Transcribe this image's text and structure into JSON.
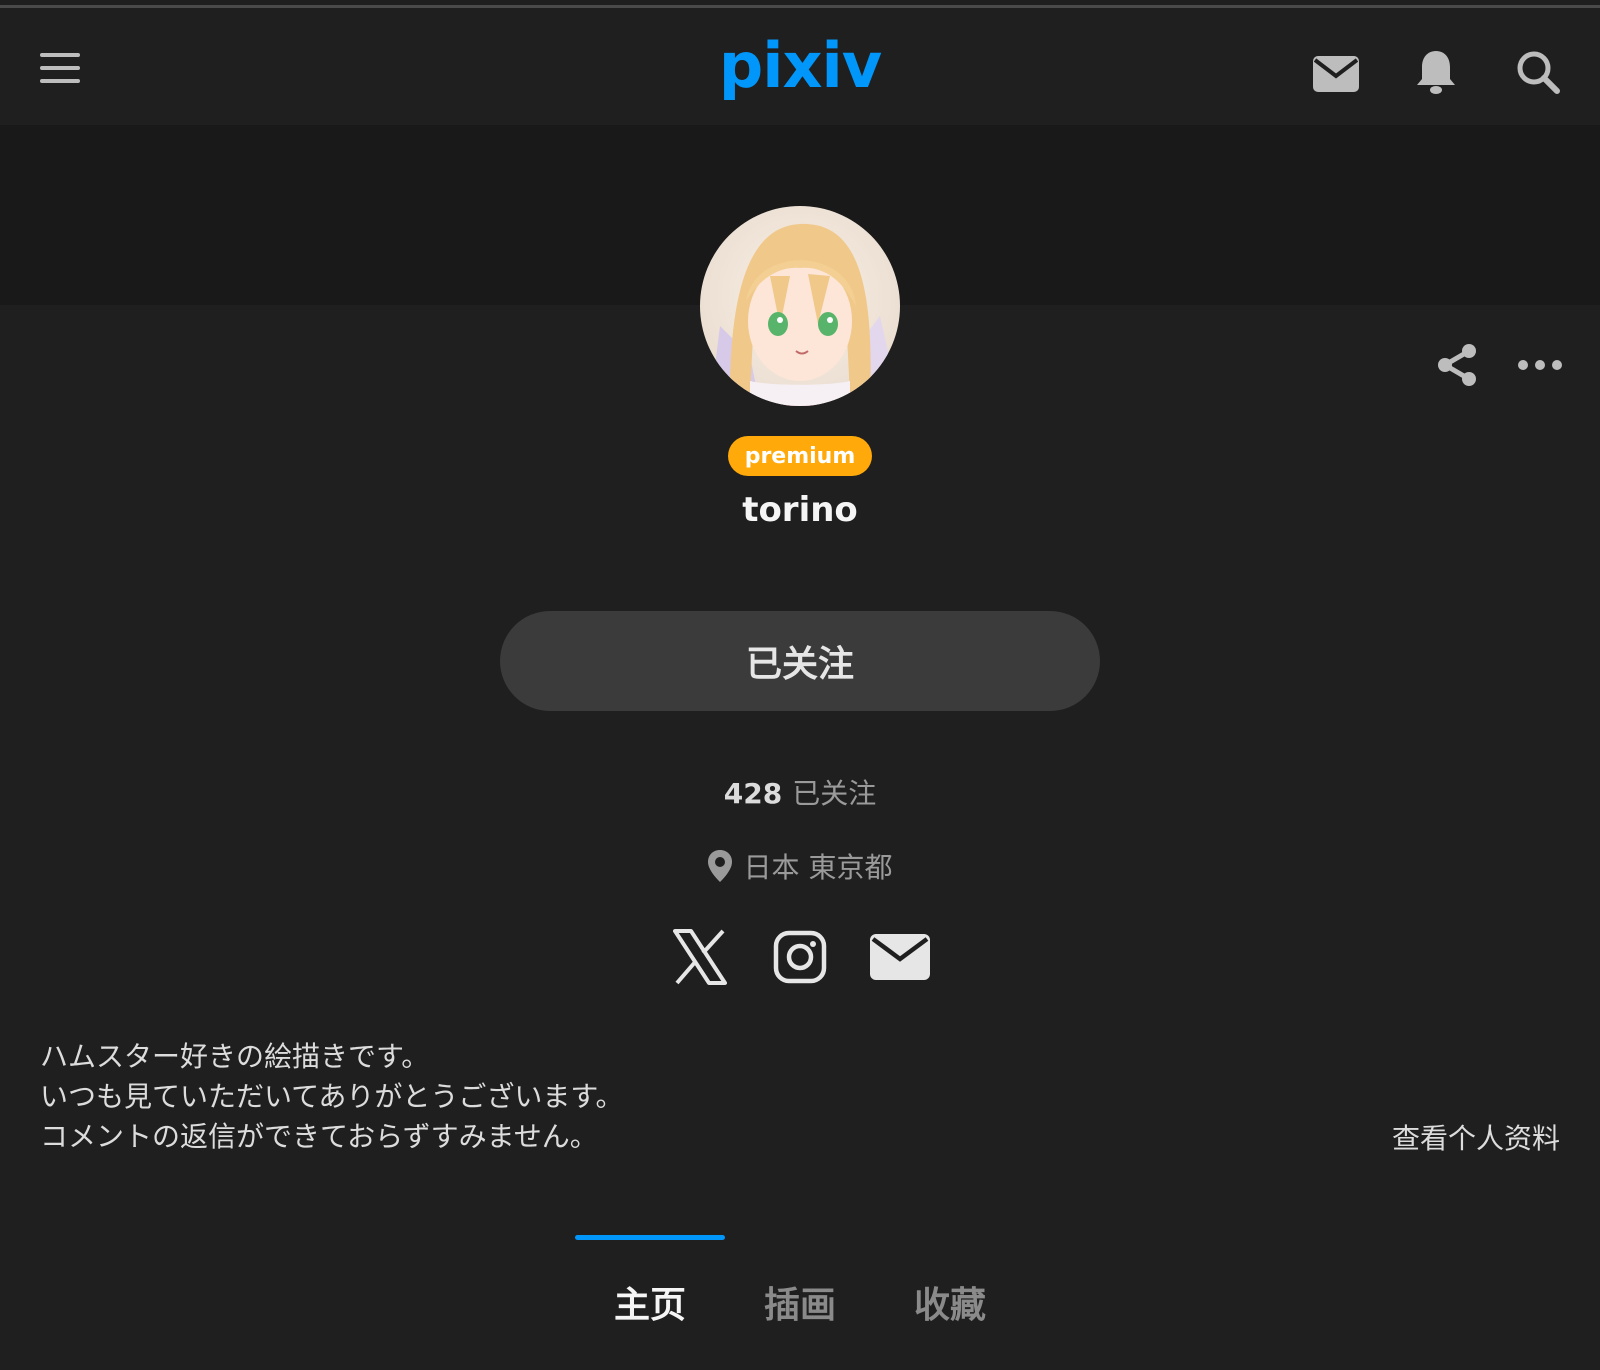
{
  "header": {
    "logo": "pixiv",
    "menu_icon": "hamburger-menu-icon",
    "mail_icon": "mail-icon",
    "bell_icon": "bell-icon",
    "search_icon": "search-icon"
  },
  "profile": {
    "badge": "premium",
    "username": "torino",
    "follow_button": "已关注",
    "following_count": "428",
    "following_label": "已关注",
    "location": "日本 東京都",
    "social_icons": [
      "x-icon",
      "instagram-icon",
      "email-icon"
    ],
    "bio_lines": [
      "ハムスター好きの絵描きです。",
      "いつも見ていただいてありがとうございます。",
      "コメントの返信ができておらずすみません。"
    ],
    "view_profile": "查看个人资料"
  },
  "tabs": [
    {
      "label": "主页",
      "active": true
    },
    {
      "label": "插画",
      "active": false
    },
    {
      "label": "收藏",
      "active": false
    }
  ],
  "colors": {
    "accent": "#0096fa",
    "premium": "#ffa90a",
    "background": "#1f1f1f",
    "cover": "#191919",
    "button": "#3b3b3b"
  }
}
